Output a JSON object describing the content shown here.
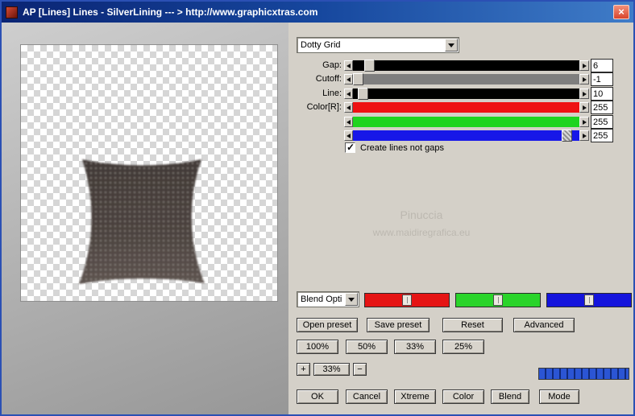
{
  "window": {
    "title": "AP [Lines]  Lines - SilverLining   --- > http://www.graphicxtras.com",
    "close_glyph": "×"
  },
  "icons": {
    "check": "✓"
  },
  "preset_dropdown": {
    "value": "Dotty Grid"
  },
  "sliders": [
    {
      "label": "Gap:",
      "value": "6",
      "track_color": "#000000",
      "thumb_left": "5%",
      "thumb_show": "block"
    },
    {
      "label": "Cutoff:",
      "value": "-1",
      "track_color": "#7e7e7e",
      "thumb_left": "0%",
      "thumb_show": "block"
    },
    {
      "label": "Line:",
      "value": "10",
      "track_color": "#000000",
      "thumb_left": "2%",
      "thumb_show": "block"
    },
    {
      "label": "Color[R]:",
      "value": "255",
      "track_color": "#ee1212",
      "thumb_left": "100%",
      "thumb_show": "none"
    },
    {
      "label": "",
      "value": "255",
      "track_color": "#1fd41f",
      "thumb_left": "100%",
      "thumb_show": "none"
    },
    {
      "label": "",
      "value": "255",
      "track_color": "#1717e8",
      "thumb_left": "92%",
      "thumb_show": "block"
    }
  ],
  "options": {
    "create_lines_label": "Create lines not gaps",
    "checked": true
  },
  "watermark": {
    "line1": "Pinuccia",
    "line2": "www.maidiregrafica.eu"
  },
  "blend": {
    "dropdown_value": "Blend Opti",
    "mini_sliders": [
      {
        "name": "red",
        "color": "#e51414"
      },
      {
        "name": "green",
        "color": "#2ad42a"
      },
      {
        "name": "blue",
        "color": "#1414dc"
      }
    ]
  },
  "buttons": {
    "open_preset": "Open preset",
    "save_preset": "Save preset",
    "reset": "Reset",
    "advanced": "Advanced",
    "zoom_100": "100%",
    "zoom_50": "50%",
    "zoom_33": "33%",
    "zoom_25": "25%",
    "zoom_plus": "+",
    "zoom_value": "33%",
    "zoom_minus": "−",
    "ok": "OK",
    "cancel": "Cancel",
    "xtreme": "Xtreme",
    "color": "Color",
    "blend": "Blend",
    "mode": "Mode"
  },
  "progress": {
    "color": "#2b55d4"
  }
}
